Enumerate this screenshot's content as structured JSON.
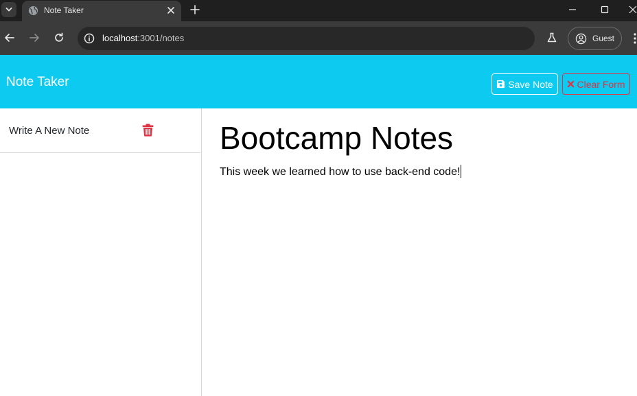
{
  "browser": {
    "tab_title": "Note Taker",
    "url_host": "localhost",
    "url_path": ":3001/notes",
    "profile_label": "Guest"
  },
  "app": {
    "brand": "Note Taker",
    "save_label": "Save Note",
    "clear_label": "Clear Form",
    "accent_color": "#0dcaf0",
    "danger_color": "#dc3545"
  },
  "sidebar": {
    "items": [
      {
        "title": "Write A New Note"
      }
    ]
  },
  "note": {
    "title": "Bootcamp Notes",
    "text": "This week we learned how to use back-end code!"
  }
}
